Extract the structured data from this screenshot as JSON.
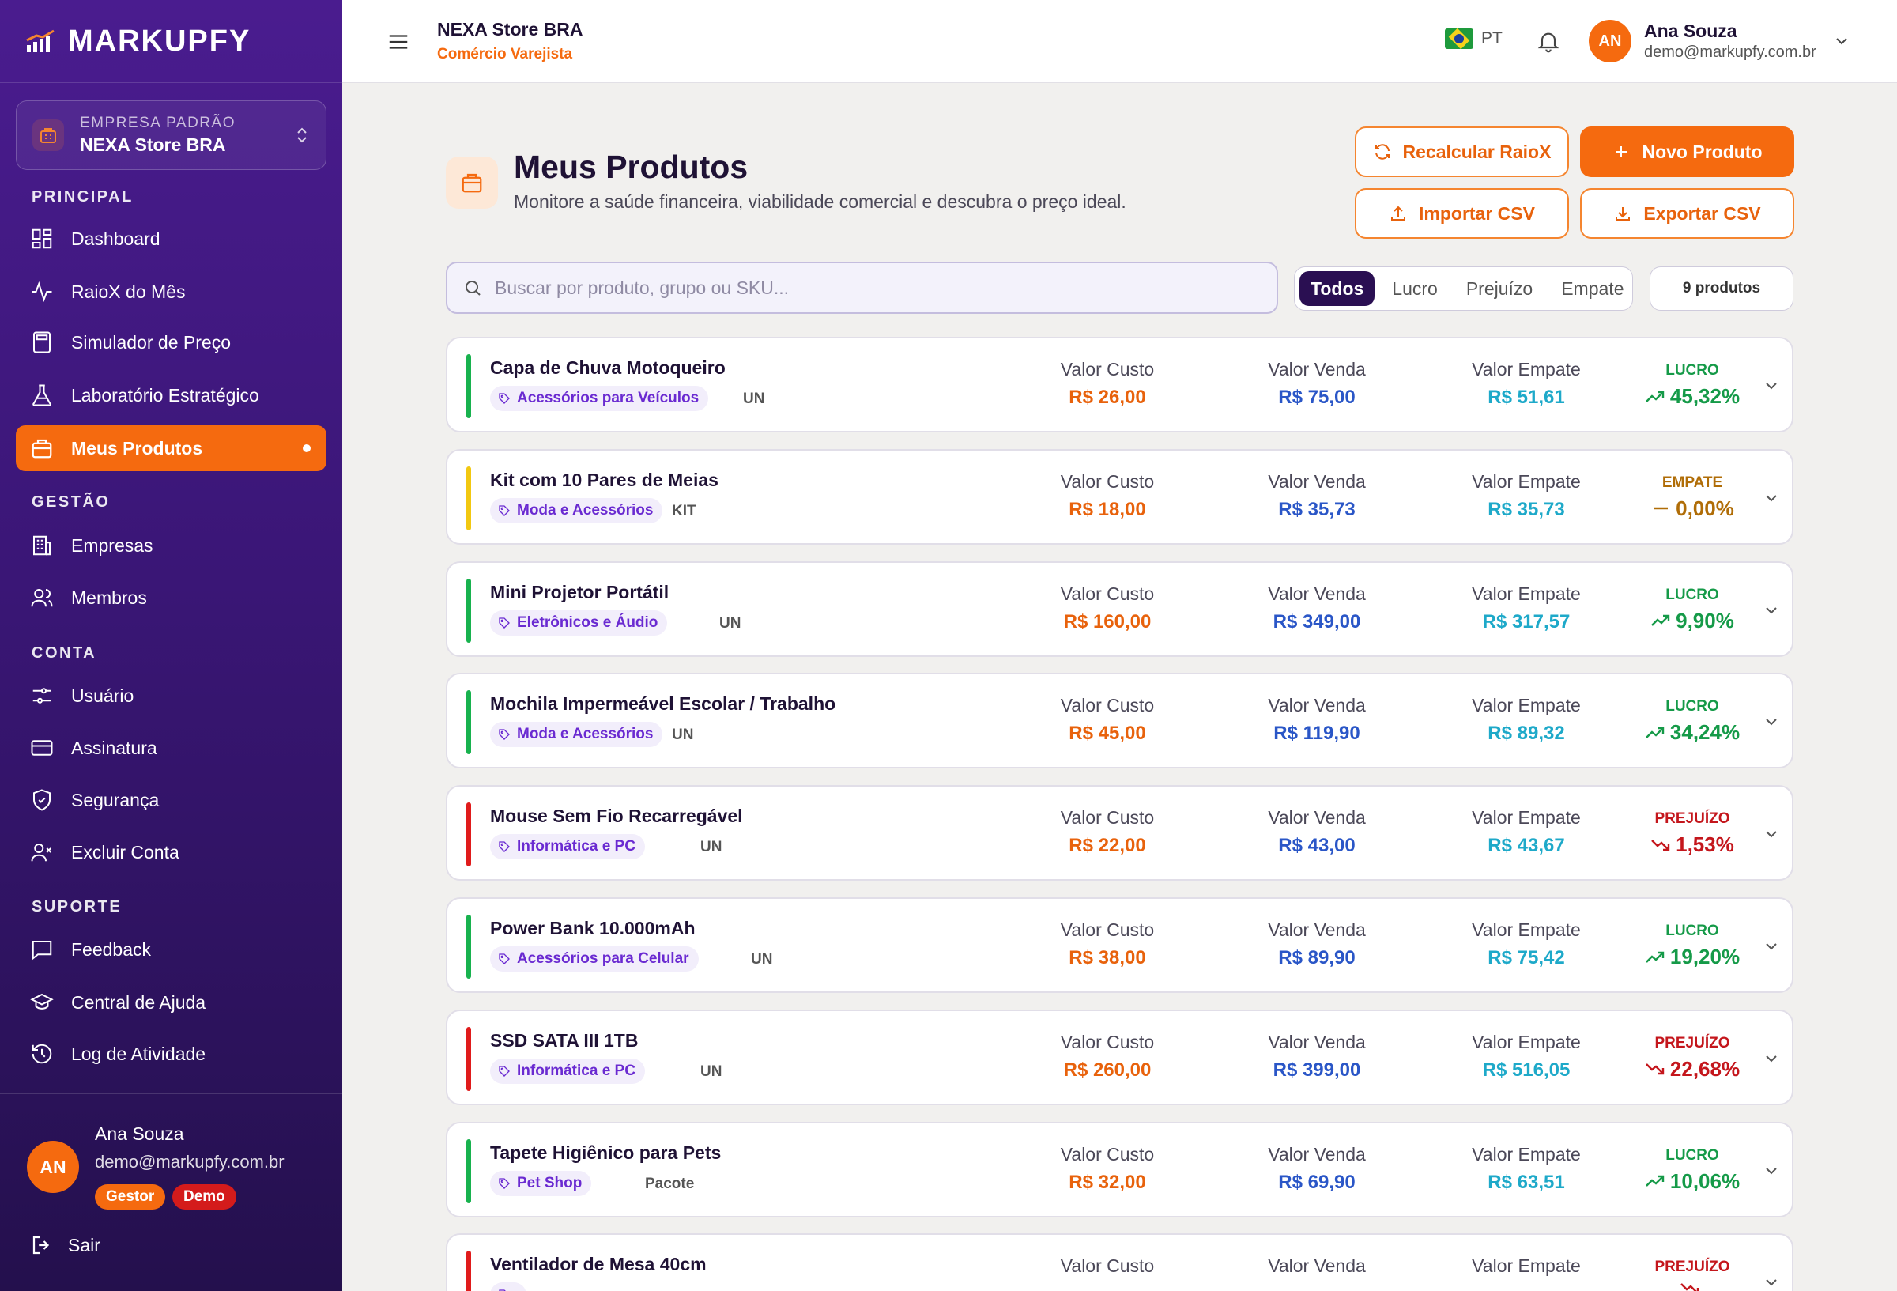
{
  "app": {
    "logo": "MARKUPFY"
  },
  "sidebar": {
    "company_label": "EMPRESA PADRÃO",
    "company_name": "NEXA Store BRA",
    "sections": {
      "principal": "PRINCIPAL",
      "gestao": "GESTÃO",
      "conta": "CONTA",
      "suporte": "SUPORTE"
    },
    "items": {
      "dashboard": "Dashboard",
      "raiox": "RaioX do Mês",
      "simulador": "Simulador de Preço",
      "laboratorio": "Laboratório Estratégico",
      "produtos": "Meus Produtos",
      "empresas": "Empresas",
      "membros": "Membros",
      "usuario": "Usuário",
      "assinatura": "Assinatura",
      "seguranca": "Segurança",
      "excluir": "Excluir Conta",
      "feedback": "Feedback",
      "ajuda": "Central de Ajuda",
      "log": "Log de Atividade"
    },
    "user": {
      "initials": "AN",
      "name": "Ana Souza",
      "email": "demo@markupfy.com.br",
      "badge_role": "Gestor",
      "badge_demo": "Demo"
    },
    "logout": "Sair"
  },
  "topbar": {
    "store_name": "NEXA Store BRA",
    "store_type": "Comércio Varejista",
    "language": "PT",
    "user_initials": "AN",
    "user_name": "Ana Souza",
    "user_email": "demo@markupfy.com.br"
  },
  "page": {
    "title": "Meus Produtos",
    "subtitle": "Monitore a saúde financeira, viabilidade comercial e descubra o preço ideal.",
    "buttons": {
      "recalc": "Recalcular RaioX",
      "new_product": "Novo Produto",
      "import": "Importar CSV",
      "export": "Exportar CSV"
    },
    "search_placeholder": "Buscar por produto, grupo ou SKU...",
    "filters": {
      "all": "Todos",
      "profit": "Lucro",
      "loss": "Prejuízo",
      "breakeven": "Empate"
    },
    "count": "9 produtos",
    "col_labels": {
      "cost": "Valor Custo",
      "sale": "Valor Venda",
      "breakeven": "Valor Empate"
    }
  },
  "colors": {
    "brand_orange": "#f56a0f",
    "sidebar_purple": "#4a1c8f",
    "profit": "#159a48",
    "breakeven": "#b06d07",
    "loss": "#c4161c"
  },
  "products": [
    {
      "name": "Capa de Chuva Motoqueiro",
      "category": "Acessórios para Veículos",
      "unit": "UN",
      "cost": "R$ 26,00",
      "sale": "R$ 75,00",
      "breakeven": "R$ 51,61",
      "status": "LUCRO",
      "margin": "45,32%",
      "kind": "lucro"
    },
    {
      "name": "Kit com 10 Pares de Meias",
      "category": "Moda e Acessórios",
      "unit": "KIT",
      "cost": "R$ 18,00",
      "sale": "R$ 35,73",
      "breakeven": "R$ 35,73",
      "status": "EMPATE",
      "margin": "0,00%",
      "kind": "empate"
    },
    {
      "name": "Mini Projetor Portátil",
      "category": "Eletrônicos e Áudio",
      "unit": "UN",
      "cost": "R$ 160,00",
      "sale": "R$ 349,00",
      "breakeven": "R$ 317,57",
      "status": "LUCRO",
      "margin": "9,90%",
      "kind": "lucro"
    },
    {
      "name": "Mochila Impermeável Escolar / Trabalho",
      "category": "Moda e Acessórios",
      "unit": "UN",
      "cost": "R$ 45,00",
      "sale": "R$ 119,90",
      "breakeven": "R$ 89,32",
      "status": "LUCRO",
      "margin": "34,24%",
      "kind": "lucro"
    },
    {
      "name": "Mouse Sem Fio Recarregável",
      "category": "Informática e PC",
      "unit": "UN",
      "cost": "R$ 22,00",
      "sale": "R$ 43,00",
      "breakeven": "R$ 43,67",
      "status": "PREJUÍZO",
      "margin": "1,53%",
      "kind": "prejuizo"
    },
    {
      "name": "Power Bank 10.000mAh",
      "category": "Acessórios para Celular",
      "unit": "UN",
      "cost": "R$ 38,00",
      "sale": "R$ 89,90",
      "breakeven": "R$ 75,42",
      "status": "LUCRO",
      "margin": "19,20%",
      "kind": "lucro"
    },
    {
      "name": "SSD SATA III 1TB",
      "category": "Informática e PC",
      "unit": "UN",
      "cost": "R$ 260,00",
      "sale": "R$ 399,00",
      "breakeven": "R$ 516,05",
      "status": "PREJUÍZO",
      "margin": "22,68%",
      "kind": "prejuizo"
    },
    {
      "name": "Tapete Higiênico para Pets",
      "category": "Pet Shop",
      "unit": "Pacote",
      "cost": "R$ 32,00",
      "sale": "R$ 69,90",
      "breakeven": "R$ 63,51",
      "status": "LUCRO",
      "margin": "10,06%",
      "kind": "lucro"
    },
    {
      "name": "Ventilador de Mesa 40cm",
      "category": "",
      "unit": "",
      "cost": "",
      "sale": "",
      "breakeven": "",
      "status": "PREJUÍZO",
      "margin": "",
      "kind": "prejuizo"
    }
  ]
}
